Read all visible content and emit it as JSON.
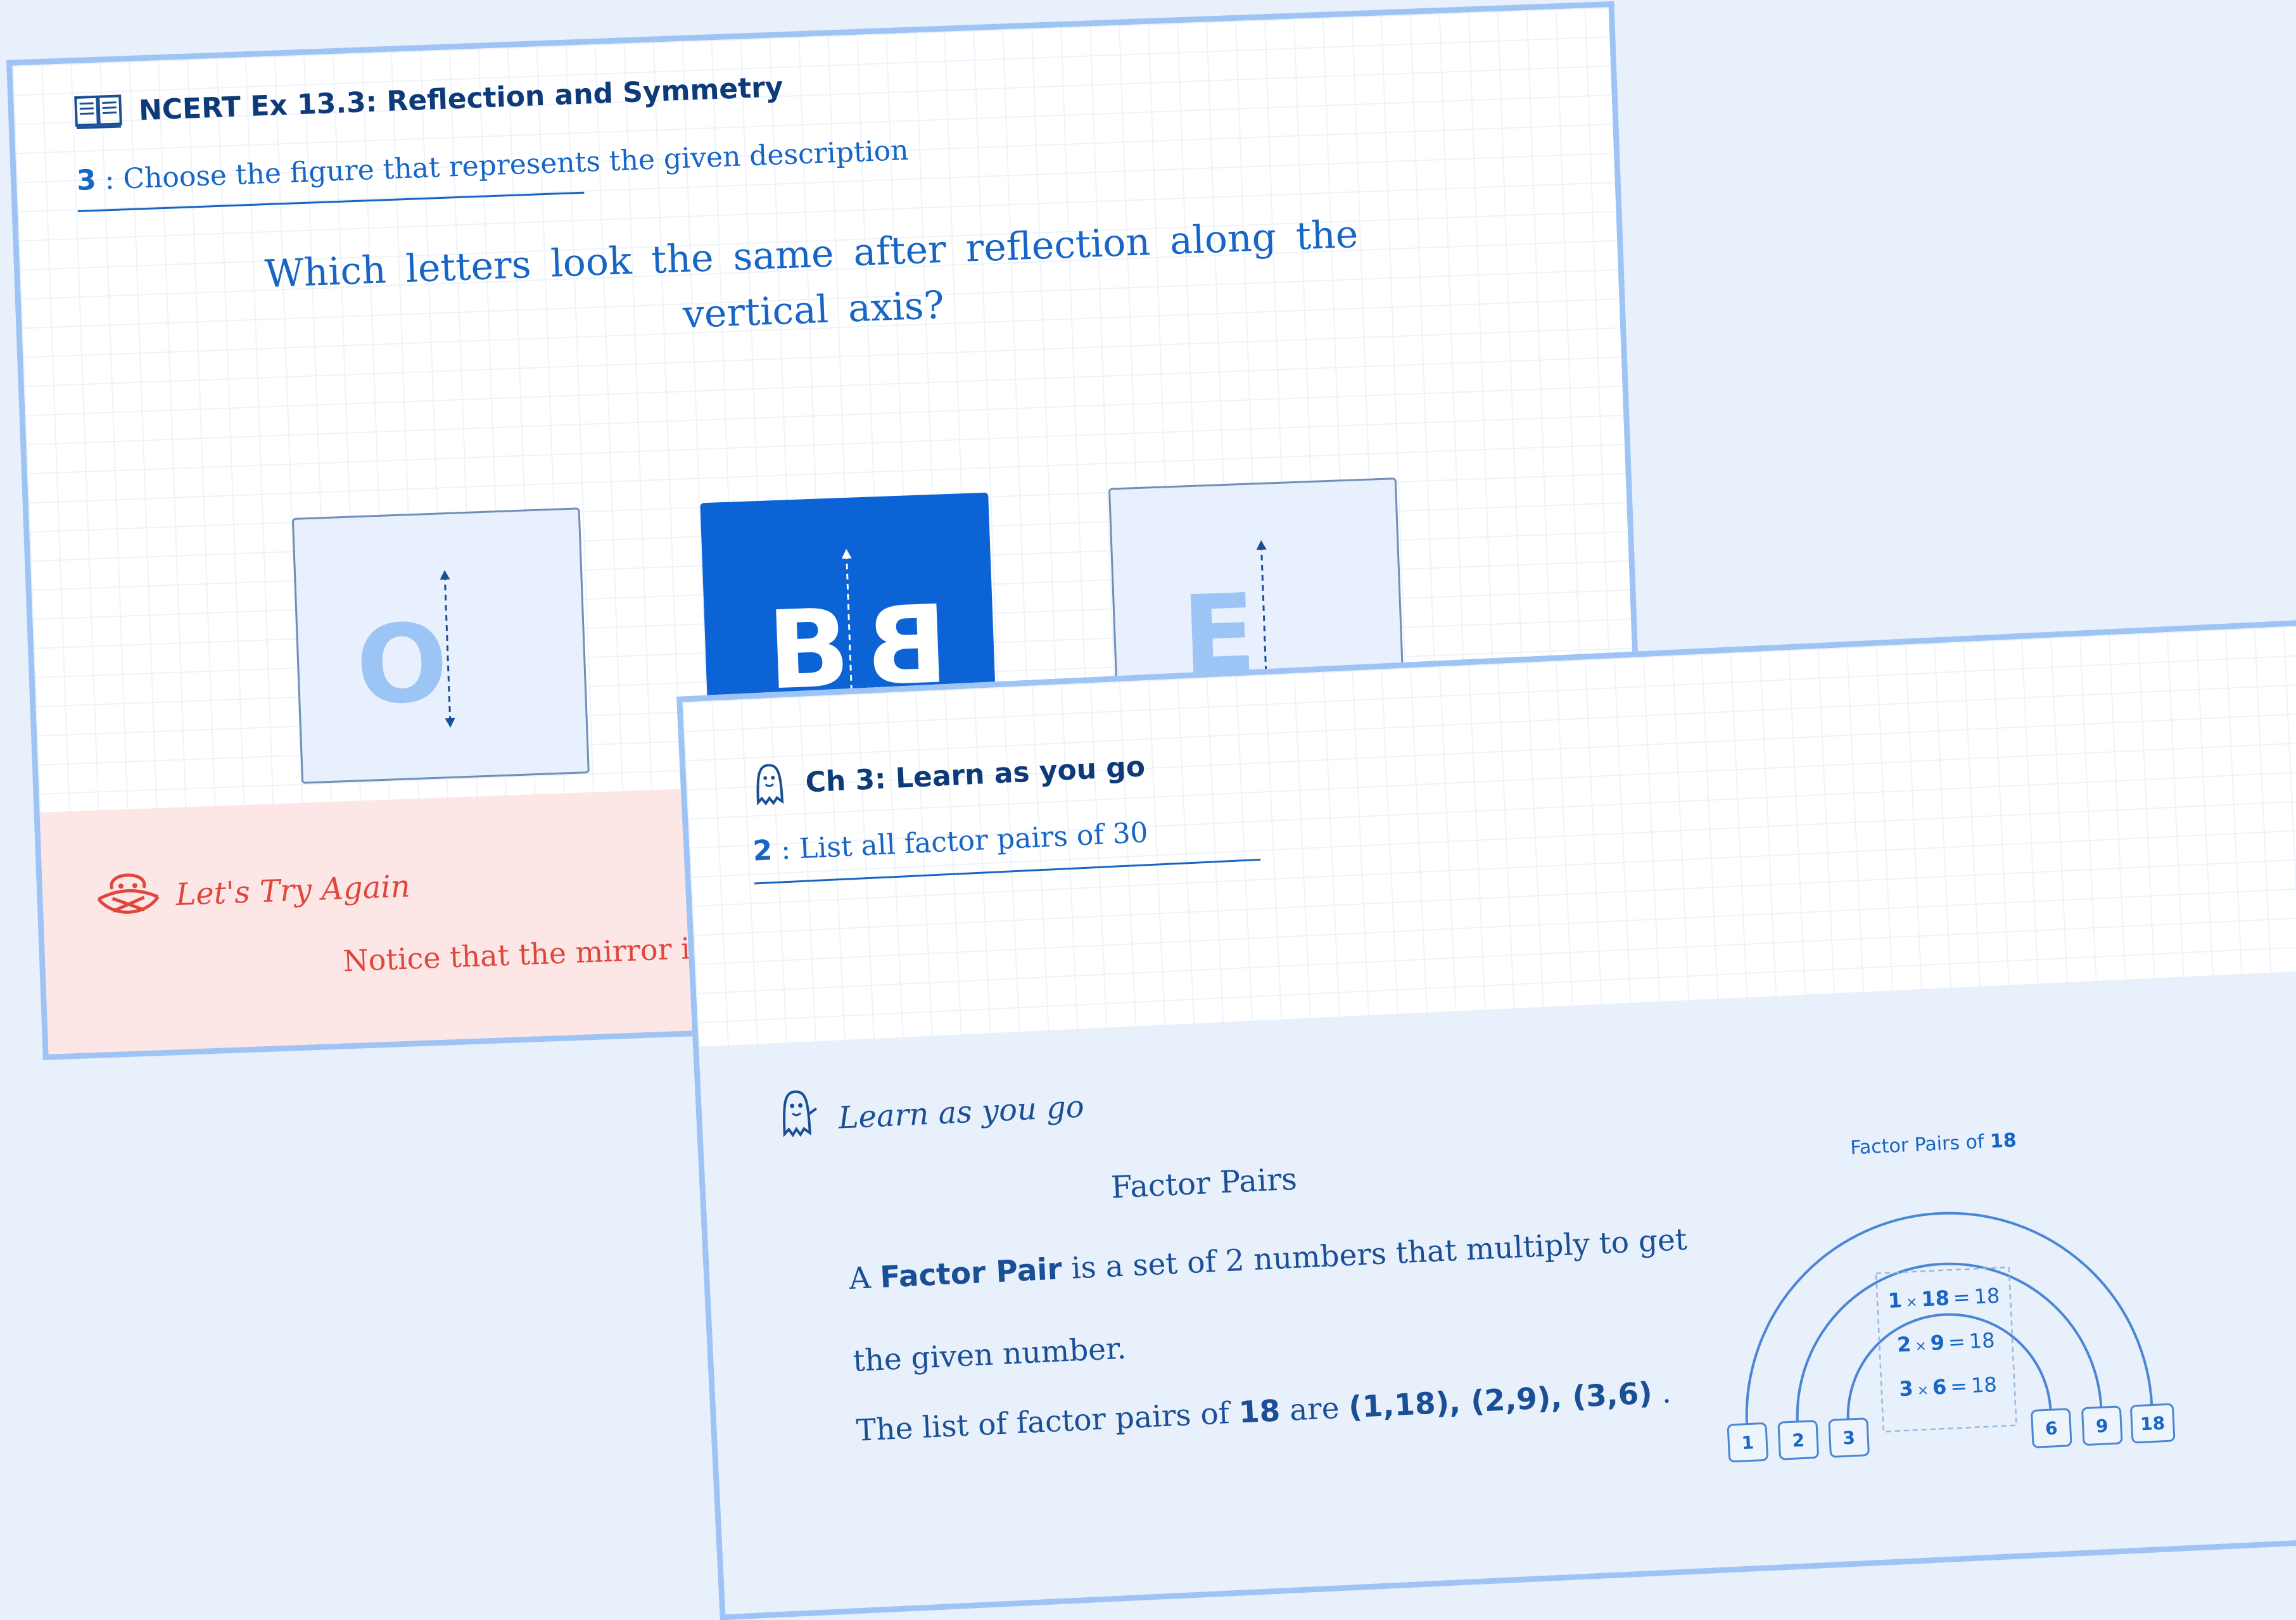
{
  "card_a": {
    "header_title": "NCERT Ex 13.3: Reflection and Symmetry",
    "question_number": "3",
    "question_sep": " : ",
    "question_instruction": "Choose the figure that represents the given description",
    "question_text": "Which letters look the same after reflection along the vertical axis?",
    "options": [
      {
        "letter": "O",
        "mirror": ""
      },
      {
        "letter": "B",
        "mirror": "B"
      },
      {
        "letter": "E",
        "mirror": ""
      }
    ],
    "feedback": {
      "title": "Let's Try Again",
      "text": "Notice that the mirror ima"
    }
  },
  "card_b": {
    "header_title": "Ch 3: Learn as you go",
    "question_number": "2",
    "question_sep": " : ",
    "question_instruction": "List all factor pairs of 30",
    "learn_title": "Learn as you go",
    "heading": "Factor Pairs",
    "line1_pre": "A ",
    "line1_bold": "Factor Pair",
    "line1_post": " is a set of 2 numbers that multiply to get",
    "line2": "the given number.",
    "line3_pre": "The list of factor pairs of ",
    "line3_num": "18",
    "line3_mid": " are ",
    "line3_pairs": "(1,18), (2,9), (3,6)",
    "line3_end": " .",
    "diagram": {
      "title_pre": "Factor Pairs of ",
      "title_num": "18",
      "factors": [
        "1",
        "2",
        "3",
        "6",
        "9",
        "18"
      ],
      "equations": [
        {
          "a": "1",
          "b": "18",
          "result": "18"
        },
        {
          "a": "2",
          "b": "9",
          "result": "18"
        },
        {
          "a": "3",
          "b": "6",
          "result": "18"
        }
      ],
      "times": "×",
      "equals": "="
    }
  }
}
